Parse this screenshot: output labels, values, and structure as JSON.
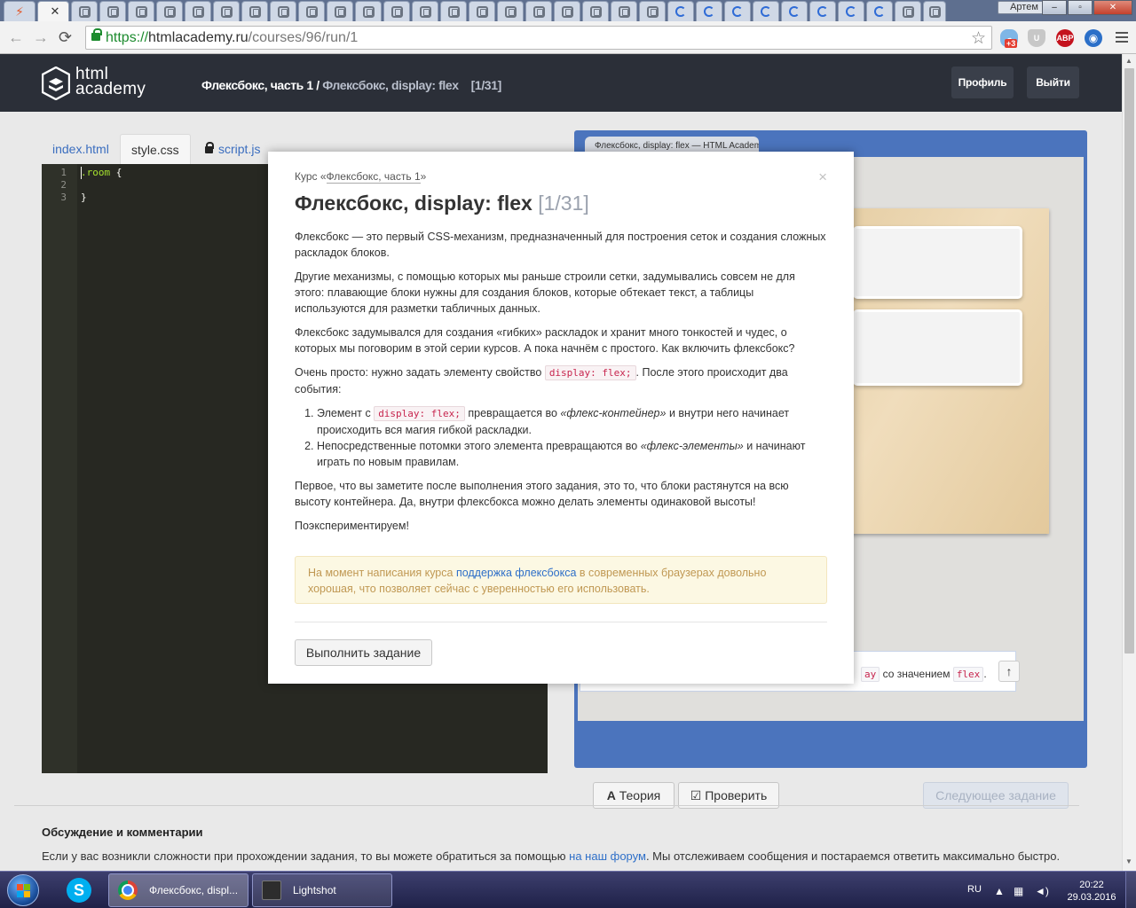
{
  "window": {
    "user_label": "Артем",
    "minimize": "–",
    "maximize": "▫",
    "close": "✕"
  },
  "browser": {
    "url_scheme": "https://",
    "url_host": "htmlacademy.ru",
    "url_path": "/courses/96/run/1",
    "ext_badge": "+3",
    "ext_abp": "ABP"
  },
  "site": {
    "logo_line1": "html",
    "logo_line2": "academy",
    "crumb_course": "Флексбокс, часть 1",
    "crumb_sep": " / ",
    "crumb_current": "Флексбокс, display: flex",
    "crumb_count": "[1/31]",
    "profile_button": "Профиль",
    "logout_button": "Выйти"
  },
  "editor": {
    "tabs": [
      {
        "label": "index.html"
      },
      {
        "label": "style.css"
      },
      {
        "label": "script.js"
      }
    ],
    "lines": [
      {
        "num": "1",
        "selector": ".room",
        "rest": " {"
      },
      {
        "num": "2",
        "selector": "",
        "rest": ""
      },
      {
        "num": "3",
        "selector": "",
        "rest": "}"
      }
    ]
  },
  "result": {
    "tab_title": "Флексбокс, display: flex — HTML Academy",
    "task_hint_prefix": "со значением",
    "task_hint_value": "flex",
    "task_hint_prop_tail": "ay",
    "task_hint_suffix": ".",
    "scroll_top": "↑",
    "theory_button": "Теория",
    "theory_icon": "A",
    "check_button": "Проверить",
    "check_icon": "☑",
    "next_button": "Следующее задание"
  },
  "discussion": {
    "title": "Обсуждение и комментарии",
    "text_before": "Если у вас возникли сложности при прохождении задания, то вы можете обратиться за помощью ",
    "link": "на наш форум",
    "text_after": ". Мы отслеживаем сообщения и постараемся ответить максимально быстро."
  },
  "modal": {
    "course_prefix": "Курс «",
    "course_link": "Флексбокс, часть 1",
    "course_suffix": "»",
    "close": "×",
    "title": "Флексбокс, display: flex",
    "title_count": "[1/31]",
    "p1": "Флексбокс — это первый CSS-механизм, предназначенный для построения сеток и создания сложных раскладок блоков.",
    "p2": "Другие механизмы, с помощью которых мы раньше строили сетки, задумывались совсем не для этого: плавающие блоки нужны для создания блоков, которые обтекает текст, а таблицы используются для разметки табличных данных.",
    "p3": "Флексбокс задумывался для создания «гибких» раскладок и хранит много тонкостей и чудес, о которых мы поговорим в этой серии курсов. А пока начнём с простого. Как включить флексбокс?",
    "p4_before": "Очень просто: нужно задать элементу свойство ",
    "p4_code": "display: flex;",
    "p4_after": ". После этого происходит два события:",
    "li1_before": "Элемент с ",
    "li1_code": "display: flex;",
    "li1_mid": " превращается во ",
    "li1_em": "«флекс-контейнер»",
    "li1_after": " и внутри него начинает происходить вся магия гибкой раскладки.",
    "li2_before": "Непосредственные потомки этого элемента превращаются во ",
    "li2_em": "«флекс-элементы»",
    "li2_after": " и начинают играть по новым правилам.",
    "p5": "Первое, что вы заметите после выполнения этого задания, это то, что блоки растянутся на всю высоту контейнера. Да, внутри флексбокса можно делать элементы одинаковой высоты!",
    "p6": "Поэкспериментируем!",
    "alert_before": "На момент написания курса ",
    "alert_link": "поддержка флексбокса",
    "alert_after": " в современных браузерах довольно хорошая, что позволяет сейчас с уверенностью его использовать.",
    "button": "Выполнить задание"
  },
  "taskbar": {
    "chrome_item": "Флексбокс, displ...",
    "lightshot_item": "Lightshot",
    "skype": "S",
    "lang": "RU",
    "time": "20:22",
    "date": "29.03.2016"
  },
  "colors": {
    "header_bg": "#2b2f38",
    "result_frame": "#4b74bd",
    "editor_bg": "#272822",
    "link": "#2e6fc8",
    "code_red": "#c7254e"
  }
}
